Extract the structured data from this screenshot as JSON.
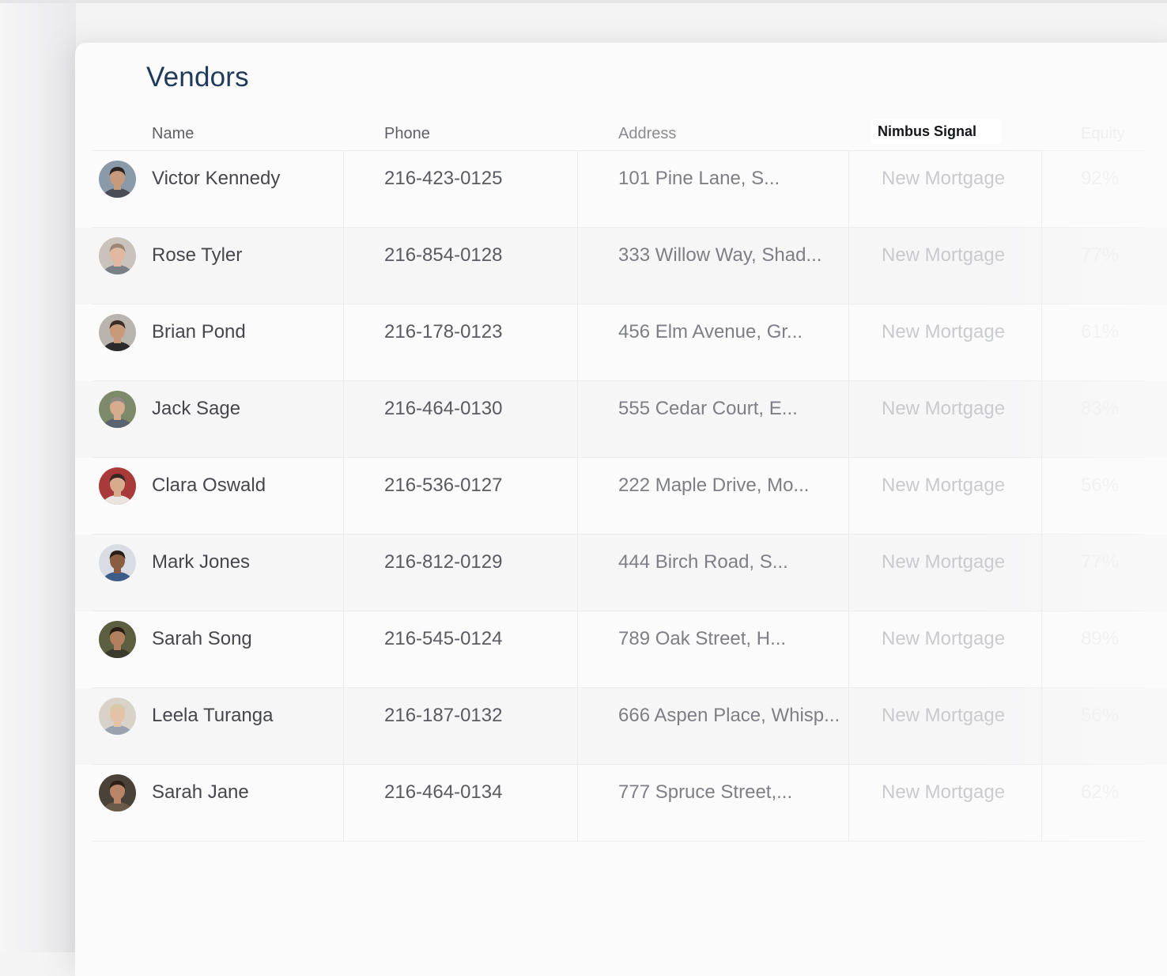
{
  "page": {
    "title": "Vendors"
  },
  "columns": {
    "name": "Name",
    "phone": "Phone",
    "address": "Address",
    "signal": "Nimbus Signal",
    "equity": "Equity"
  },
  "vendors": [
    {
      "name": "Victor Kennedy",
      "phone": "216-423-0125",
      "address": "101 Pine Lane, S...",
      "signal": "New Mortgage",
      "equity": "92%",
      "avatar": {
        "bg": "#8a9aa8",
        "skin": "#c69a7c",
        "hair": "#2b2420",
        "shirt": "#4a4f57"
      }
    },
    {
      "name": "Rose Tyler",
      "phone": "216-854-0128",
      "address": "333 Willow Way, Shad...",
      "signal": "New Mortgage",
      "equity": "77%",
      "avatar": {
        "bg": "#c9c3bb",
        "skin": "#e0b9a0",
        "hair": "#9b8674",
        "shirt": "#7b7f86"
      }
    },
    {
      "name": "Brian Pond",
      "phone": "216-178-0123",
      "address": "456 Elm Avenue, Gr...",
      "signal": "New Mortgage",
      "equity": "61%",
      "avatar": {
        "bg": "#b9b5ae",
        "skin": "#c99a7a",
        "hair": "#3a2e26",
        "shirt": "#2a2a2c"
      }
    },
    {
      "name": "Jack Sage",
      "phone": "216-464-0130",
      "address": "555 Cedar Court, E...",
      "signal": "New Mortgage",
      "equity": "83%",
      "avatar": {
        "bg": "#7d8a6a",
        "skin": "#d5ad8e",
        "hair": "#8f8a82",
        "shirt": "#5a6470"
      }
    },
    {
      "name": "Clara Oswald",
      "phone": "216-536-0127",
      "address": "222 Maple Drive, Mo...",
      "signal": "New Mortgage",
      "equity": "56%",
      "avatar": {
        "bg": "#a83a3a",
        "skin": "#d9ab8e",
        "hair": "#3a2620",
        "shirt": "#e8e4df"
      }
    },
    {
      "name": "Mark Jones",
      "phone": "216-812-0129",
      "address": "444 Birch Road, S...",
      "signal": "New Mortgage",
      "equity": "77%",
      "avatar": {
        "bg": "#d9dde3",
        "skin": "#8a5d42",
        "hair": "#2a1e18",
        "shirt": "#3c5d8a"
      }
    },
    {
      "name": "Sarah Song",
      "phone": "216-545-0124",
      "address": "789 Oak Street, H...",
      "signal": "New Mortgage",
      "equity": "89%",
      "avatar": {
        "bg": "#5b5f3f",
        "skin": "#b0805f",
        "hair": "#2a1c14",
        "shirt": "#3a3b2c"
      }
    },
    {
      "name": "Leela Turanga",
      "phone": "216-187-0132",
      "address": "666 Aspen Place, Whisp...",
      "signal": "New Mortgage",
      "equity": "56%",
      "avatar": {
        "bg": "#d8d2c9",
        "skin": "#e4c2a8",
        "hair": "#d8c9a6",
        "shirt": "#9aa3ad"
      }
    },
    {
      "name": "Sarah Jane",
      "phone": "216-464-0134",
      "address": "777 Spruce Street,...",
      "signal": "New Mortgage",
      "equity": "62%",
      "avatar": {
        "bg": "#4a4238",
        "skin": "#b88666",
        "hair": "#2e2018",
        "shirt": "#6a5a4a"
      }
    }
  ]
}
